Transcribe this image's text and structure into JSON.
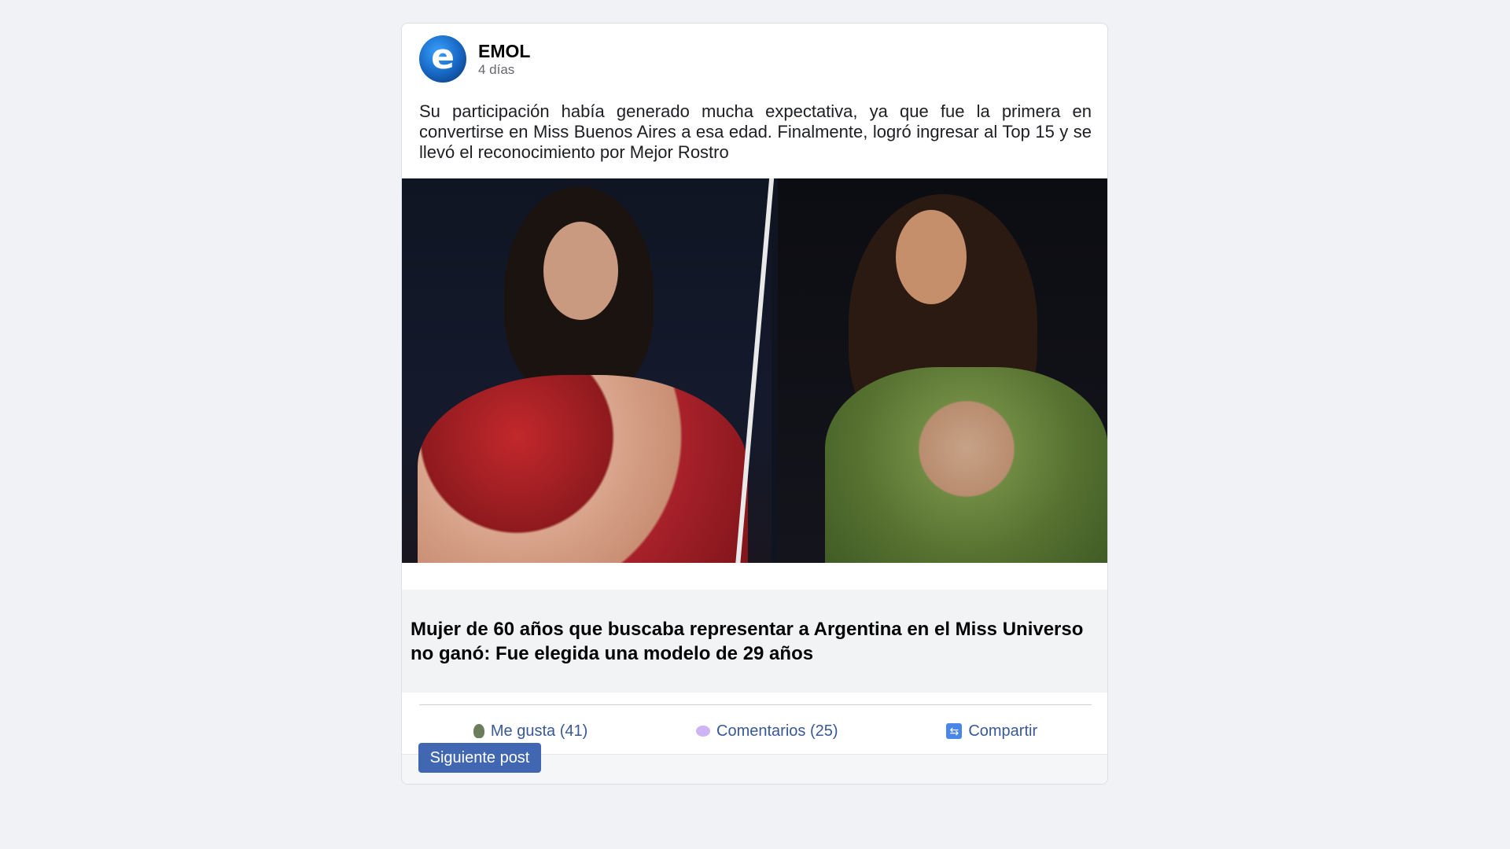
{
  "post": {
    "page_name": "EMOL",
    "avatar_letter": "e",
    "time": "4 días",
    "body": "Su participación había generado mucha expectativa, ya que fue la primera en convertirse en Miss Buenos Aires a esa edad. Finalmente, logró ingresar al Top 15 y se llevó el reconocimiento por Mejor Rostro",
    "title": "Mujer de 60 años que buscaba representar a Argentina en el Miss Universo no ganó: Fue elegida una modelo de 29 años"
  },
  "actions": {
    "like_label": "Me gusta (41)",
    "comment_label": "Comentarios (25)",
    "share_label": "Compartir",
    "share_icon": "⇆"
  },
  "footer": {
    "next_label": "Siguiente post"
  },
  "colors": {
    "background": "#f0f2f5",
    "link_blue": "#385898",
    "button_blue": "#4267b2"
  },
  "icons": [
    "avatar-logo-icon",
    "like-icon",
    "comment-icon",
    "share-icon"
  ]
}
